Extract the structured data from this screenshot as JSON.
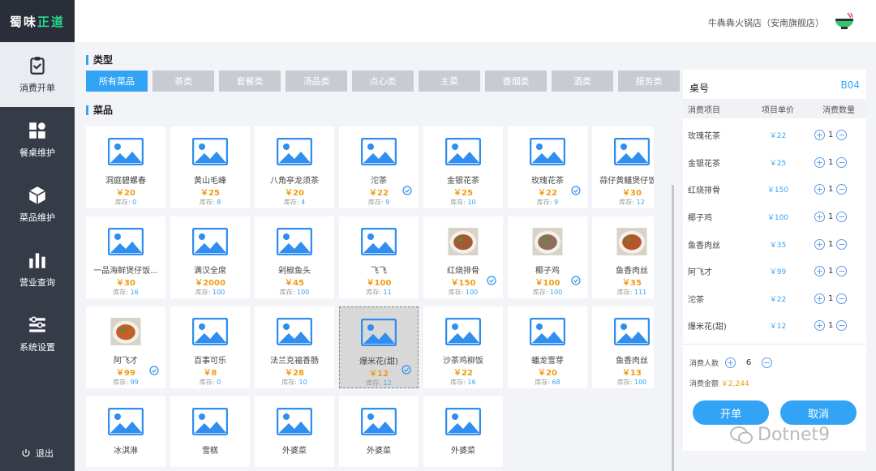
{
  "logo": {
    "part1": "蜀味",
    "part2": "正道"
  },
  "sidebar": {
    "items": [
      {
        "label": "消费开单",
        "icon": "clipboard-icon"
      },
      {
        "label": "餐桌维护",
        "icon": "grid-icon"
      },
      {
        "label": "菜品维护",
        "icon": "cube-icon"
      },
      {
        "label": "营业查询",
        "icon": "bar-chart-icon"
      },
      {
        "label": "系统设置",
        "icon": "settings-list-icon"
      }
    ],
    "logout": "退出"
  },
  "header": {
    "store_name": "牛犇犇火锅店（安南旗舰店）"
  },
  "main": {
    "type_title": "类型",
    "dish_title": "菜品",
    "categories": [
      "所有菜品",
      "茶类",
      "套餐类",
      "汤品类",
      "点心类",
      "主菜",
      "香烟类",
      "酒类",
      "服务类"
    ],
    "stock_label": "库存:",
    "dishes": [
      {
        "name": "洞庭碧螺春",
        "price": "￥20",
        "stock": "0",
        "photo": false,
        "checked": false
      },
      {
        "name": "黄山毛峰",
        "price": "￥25",
        "stock": "8",
        "photo": false,
        "checked": false
      },
      {
        "name": "八角亭龙须茶",
        "price": "￥20",
        "stock": "4",
        "photo": false,
        "checked": false
      },
      {
        "name": "沱茶",
        "price": "￥22",
        "stock": "9",
        "photo": false,
        "checked": true
      },
      {
        "name": "金银花茶",
        "price": "￥25",
        "stock": "10",
        "photo": false,
        "checked": false
      },
      {
        "name": "玫瑰花茶",
        "price": "￥22",
        "stock": "9",
        "photo": false,
        "checked": true
      },
      {
        "name": "蒜仔黄鳝煲仔饭...",
        "price": "￥30",
        "stock": "12",
        "photo": false,
        "checked": false
      },
      {
        "name": "一品海鲜煲仔饭...",
        "price": "￥30",
        "stock": "16",
        "photo": false,
        "checked": false
      },
      {
        "name": "满汉全席",
        "price": "￥2000",
        "stock": "100",
        "photo": false,
        "checked": false
      },
      {
        "name": "剁椒鱼头",
        "price": "￥45",
        "stock": "100",
        "photo": false,
        "checked": false
      },
      {
        "name": "飞飞",
        "price": "￥100",
        "stock": "11",
        "photo": false,
        "checked": false
      },
      {
        "name": "红烧排骨",
        "price": "￥150",
        "stock": "100",
        "photo": true,
        "checked": true
      },
      {
        "name": "椰子鸡",
        "price": "￥100",
        "stock": "100",
        "photo": true,
        "checked": true
      },
      {
        "name": "鱼香肉丝",
        "price": "￥35",
        "stock": "111",
        "photo": true,
        "checked": true
      },
      {
        "name": "阿飞才",
        "price": "￥99",
        "stock": "99",
        "photo": true,
        "checked": true
      },
      {
        "name": "百事可乐",
        "price": "￥8",
        "stock": "0",
        "photo": false,
        "checked": false
      },
      {
        "name": "法兰克福香肠",
        "price": "￥28",
        "stock": "10",
        "photo": false,
        "checked": false
      },
      {
        "name": "爆米花(甜)",
        "price": "￥12",
        "stock": "12",
        "photo": false,
        "checked": true,
        "selected": true
      },
      {
        "name": "沙茶鸡柳饭",
        "price": "￥22",
        "stock": "16",
        "photo": false,
        "checked": false
      },
      {
        "name": "蟠龙雪芽",
        "price": "￥20",
        "stock": "68",
        "photo": false,
        "checked": false
      },
      {
        "name": "鱼香肉丝",
        "price": "￥13",
        "stock": "100",
        "photo": false,
        "checked": false
      },
      {
        "name": "冰淇淋",
        "price": "",
        "stock": "",
        "photo": false,
        "checked": false
      },
      {
        "name": "雪糕",
        "price": "",
        "stock": "",
        "photo": false,
        "checked": false
      },
      {
        "name": "外婆菜",
        "price": "",
        "stock": "",
        "photo": false,
        "checked": false
      },
      {
        "name": "外婆菜",
        "price": "",
        "stock": "",
        "photo": false,
        "checked": false
      },
      {
        "name": "外婆菜",
        "price": "",
        "stock": "",
        "photo": false,
        "checked": false
      }
    ]
  },
  "panel": {
    "table_label": "桌号",
    "table_no": "B04",
    "col_item": "消费项目",
    "col_price": "项目单价",
    "col_qty": "消费数量",
    "orders": [
      {
        "name": "玫瑰花茶",
        "price": "￥22",
        "qty": "1"
      },
      {
        "name": "金银花茶",
        "price": "￥25",
        "qty": "1"
      },
      {
        "name": "红烧排骨",
        "price": "￥150",
        "qty": "1"
      },
      {
        "name": "椰子鸡",
        "price": "￥100",
        "qty": "1"
      },
      {
        "name": "鱼香肉丝",
        "price": "￥35",
        "qty": "1"
      },
      {
        "name": "阿飞才",
        "price": "￥99",
        "qty": "1"
      },
      {
        "name": "沱茶",
        "price": "￥22",
        "qty": "1"
      },
      {
        "name": "爆米花(甜)",
        "price": "￥12",
        "qty": "1"
      }
    ],
    "guests_label": "消费人数",
    "guests_value": "6",
    "amount_label": "消费金额",
    "amount_value": "￥2,244",
    "open_button": "开单",
    "cancel_button": "取消"
  },
  "watermark": "Dotnet9",
  "colors": {
    "accent": "#33a4f5",
    "sidebar": "#363b48",
    "price": "#f29c11",
    "logo_accent": "#28d890"
  }
}
